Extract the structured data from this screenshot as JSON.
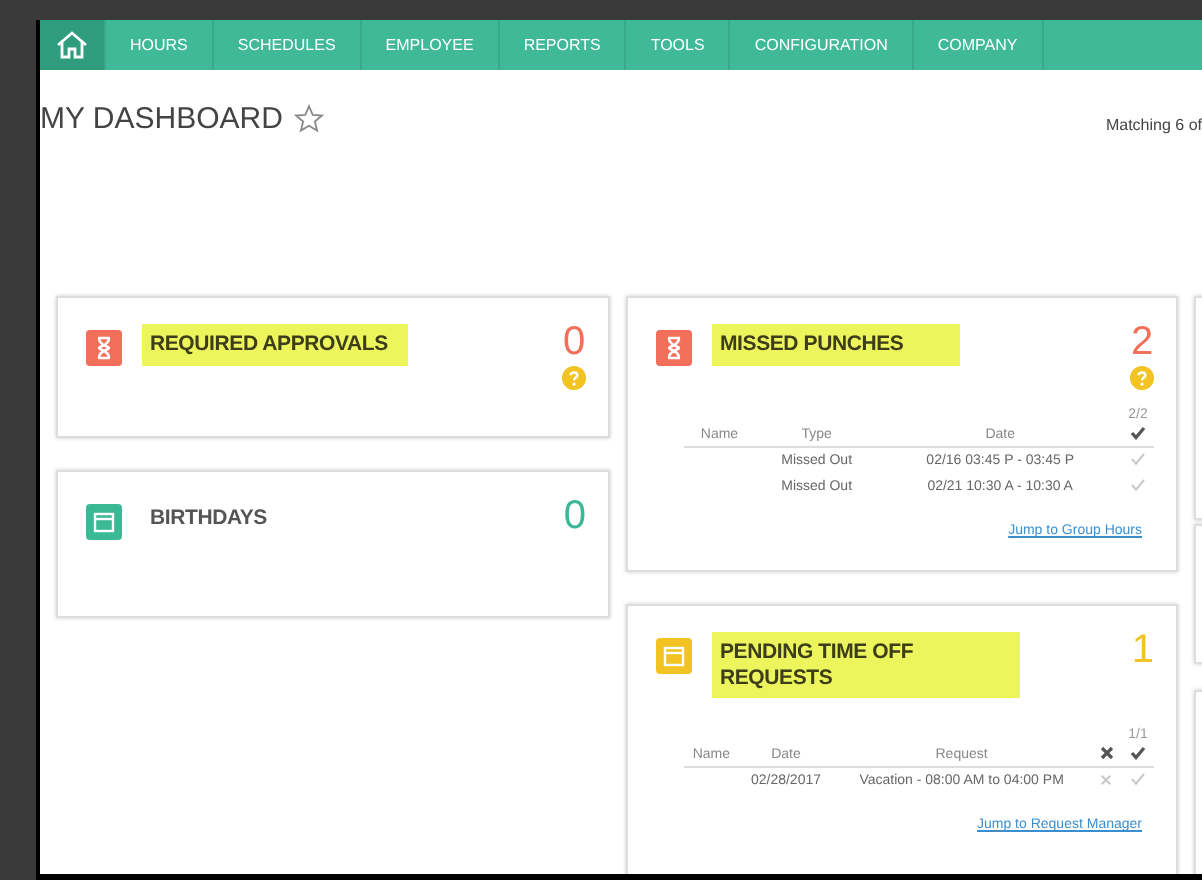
{
  "nav": {
    "home": {
      "selected": true
    },
    "items": [
      {
        "label": "HOURS",
        "selected": false
      },
      {
        "label": "SCHEDULES",
        "selected": false
      },
      {
        "label": "EMPLOYEE",
        "selected": false
      },
      {
        "label": "REPORTS",
        "selected": false
      },
      {
        "label": "TOOLS",
        "selected": false
      },
      {
        "label": "CONFIGURATION",
        "selected": false
      },
      {
        "label": "COMPANY",
        "selected": false
      }
    ]
  },
  "header": {
    "title": "MY DASHBOARD",
    "favorite": false,
    "matching": "Matching 6 of"
  },
  "columns": [
    {
      "cards": [
        {
          "title": "REQUIRED APPROVALS",
          "kind": "hourglass",
          "color": "#f26f5a",
          "count": "0",
          "highlighted": true,
          "help": true
        },
        {
          "title": "BIRTHDAYS",
          "kind": "calendar",
          "color": "#3bb896",
          "count": "0",
          "highlighted": false,
          "help": false
        }
      ]
    },
    {
      "cards": [
        {
          "title": "MISSED PUNCHES",
          "kind": "hourglass",
          "color": "#f26f5a",
          "count": "2",
          "highlighted": true,
          "help": true,
          "table": {
            "tally": "2/2",
            "columns": [
              {
                "label": "Name",
                "kind": "text"
              },
              {
                "label": "Type",
                "kind": "text"
              },
              {
                "label": "Date",
                "kind": "text"
              },
              {
                "kind": "approve"
              }
            ],
            "rows": [
              [
                "",
                "Missed Out",
                "02/16 03:45 P - 03:45 P"
              ],
              [
                "",
                "Missed Out",
                "02/21 10:30 A - 10:30 A"
              ]
            ]
          },
          "link": "Jump to Group Hours"
        },
        {
          "title": "PENDING TIME OFF REQUESTS",
          "kind": "calendar",
          "color": "#f2c322",
          "count": "1",
          "highlighted": true,
          "help": false,
          "table": {
            "tally": "1/1",
            "columns": [
              {
                "label": "Name",
                "kind": "text"
              },
              {
                "label": "Date",
                "kind": "text"
              },
              {
                "label": "Request",
                "kind": "text"
              },
              {
                "kind": "deny"
              },
              {
                "kind": "approve"
              }
            ],
            "rows": [
              [
                "",
                "02/28/2017",
                "Vacation - 08:00 AM to 04:00 PM"
              ]
            ]
          },
          "link": "Jump to Request Manager"
        }
      ]
    }
  ]
}
